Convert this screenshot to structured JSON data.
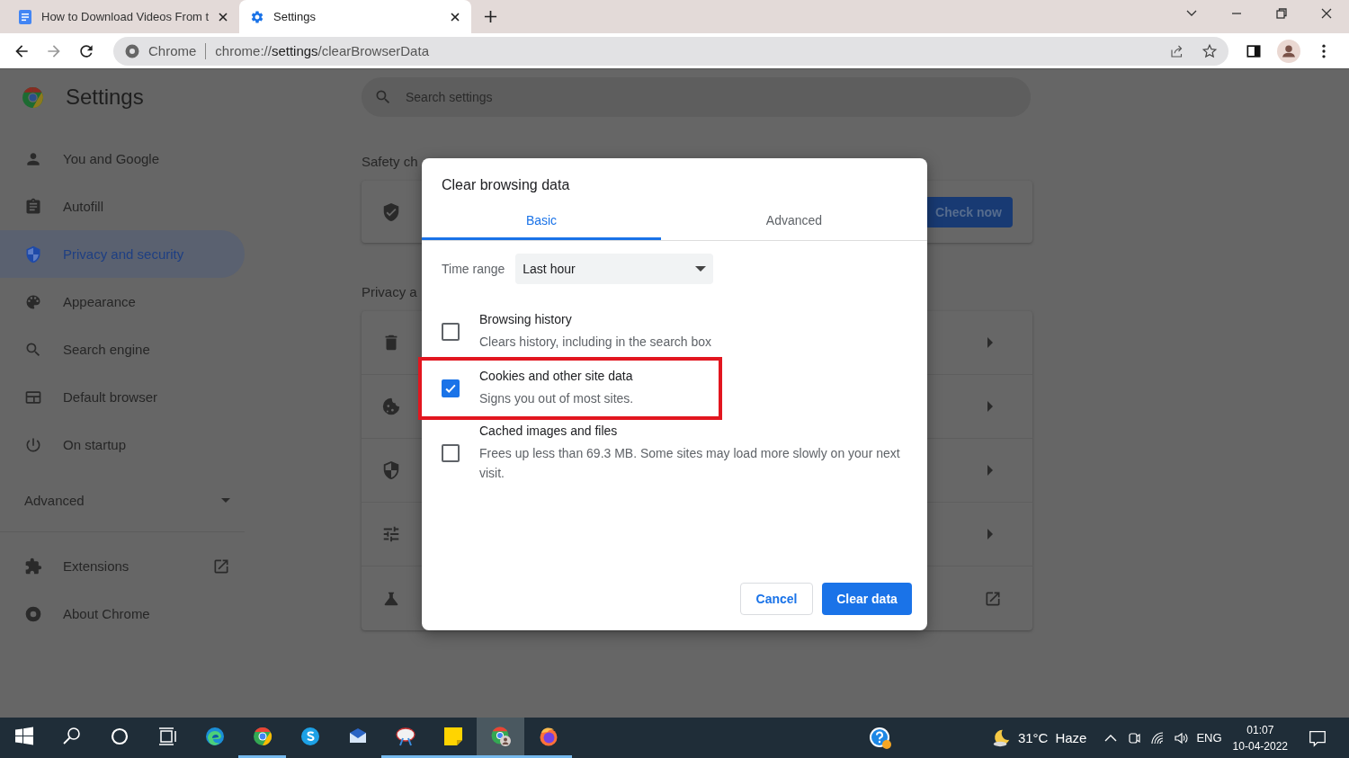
{
  "browser": {
    "tabs": [
      {
        "title": "How to Download Videos From t",
        "selected": false
      },
      {
        "title": "Settings",
        "selected": true
      }
    ],
    "address": {
      "site_label": "Chrome",
      "url_scheme": "chrome://",
      "url_host": "settings",
      "url_path": "/clearBrowserData"
    }
  },
  "settings": {
    "title": "Settings",
    "search_placeholder": "Search settings",
    "nav": [
      {
        "kind": "item",
        "label": "You and Google",
        "selected": false
      },
      {
        "kind": "item",
        "label": "Autofill",
        "selected": false
      },
      {
        "kind": "item",
        "label": "Privacy and security",
        "selected": true
      },
      {
        "kind": "item",
        "label": "Appearance",
        "selected": false
      },
      {
        "kind": "item",
        "label": "Search engine",
        "selected": false
      },
      {
        "kind": "item",
        "label": "Default browser",
        "selected": false
      },
      {
        "kind": "item",
        "label": "On startup",
        "selected": false
      },
      {
        "kind": "section",
        "label": "Advanced",
        "expanded": false
      },
      {
        "kind": "item",
        "label": "Extensions",
        "selected": false
      },
      {
        "kind": "item",
        "label": "About Chrome",
        "selected": false
      }
    ],
    "safety": {
      "heading": "Safety ch",
      "button": "Check now"
    },
    "privacy": {
      "heading": "Privacy a"
    }
  },
  "dialog": {
    "title": "Clear browsing data",
    "tabs": [
      {
        "label": "Basic",
        "selected": true
      },
      {
        "label": "Advanced",
        "selected": false
      }
    ],
    "time_range": {
      "label": "Time range",
      "value": "Last hour"
    },
    "options": [
      {
        "title": "Browsing history",
        "description": "Clears history, including in the search box",
        "checked": false,
        "highlighted": false
      },
      {
        "title": "Cookies and other site data",
        "description": "Signs you out of most sites.",
        "checked": true,
        "highlighted": true
      },
      {
        "title": "Cached images and files",
        "description": "Frees up less than 69.3 MB. Some sites may load more slowly on your next visit.",
        "checked": false,
        "highlighted": false
      }
    ],
    "buttons": [
      {
        "label": "Cancel",
        "kind": "secondary"
      },
      {
        "label": "Clear data",
        "kind": "primary"
      }
    ]
  },
  "taskbar": {
    "apps": [
      {
        "kind": "start",
        "running": false,
        "active": false
      },
      {
        "kind": "search",
        "running": false,
        "active": false
      },
      {
        "kind": "cortana",
        "running": false,
        "active": false
      },
      {
        "kind": "taskview",
        "running": false,
        "active": false
      },
      {
        "kind": "edge",
        "running": false,
        "active": false
      },
      {
        "kind": "chrome",
        "running": true,
        "active": false
      },
      {
        "kind": "skype",
        "running": false,
        "active": false
      },
      {
        "kind": "mail",
        "running": false,
        "active": false
      },
      {
        "kind": "paint",
        "running": true,
        "active": false
      },
      {
        "kind": "sticky",
        "running": true,
        "active": false
      },
      {
        "kind": "chrome-profile",
        "running": true,
        "active": true
      },
      {
        "kind": "firefox",
        "running": true,
        "active": false
      }
    ],
    "tray": {
      "temperature": "31°C",
      "weather": "Haze",
      "language": "ENG",
      "time": "01:07",
      "date": "10-04-2022"
    }
  }
}
